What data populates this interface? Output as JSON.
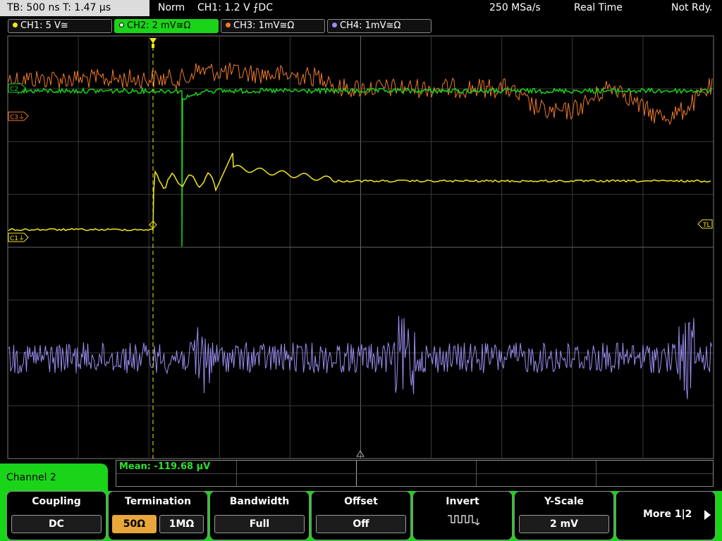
{
  "topbar": {
    "tb": "TB: 500 ns  T: 1.47 µs",
    "mode": "Norm",
    "trigger": "CH1: 1.2 V ⨍DC",
    "sample_rate": "250 MSa/s",
    "acq_mode": "Real Time",
    "status": "Not Rdy."
  },
  "channel_tabs": [
    {
      "label": "CH1: 5 V≅",
      "color": "#f0e81c"
    },
    {
      "label": "CH2: 2 mV≅Ω",
      "color": "#1ad41a"
    },
    {
      "label": "CH3: 1mV≅Ω",
      "color": "#f07a2a"
    },
    {
      "label": "CH4: 1mV≅Ω",
      "color": "#9a8ef0"
    }
  ],
  "markers": {
    "c1": "C1⏚",
    "c3": "C3⏚",
    "c2": "C2",
    "tl": "TL"
  },
  "measurement": {
    "mean": "Mean: -119.68 µV"
  },
  "menu": {
    "title": "Channel 2",
    "coupling_label": "Coupling",
    "coupling_value": "DC",
    "termination_label": "Termination",
    "termination_opt1": "50Ω",
    "termination_opt2": "1MΩ",
    "bandwidth_label": "Bandwidth",
    "bandwidth_value": "Full",
    "offset_label": "Offset",
    "offset_value": "Off",
    "invert_label": "Invert",
    "yscale_label": "Y-Scale",
    "yscale_value": "2 mV",
    "more_label": "More 1|2"
  },
  "colors": {
    "ch1": "#f0e81c",
    "ch2": "#1ad41a",
    "ch3": "#f07a2a",
    "ch4": "#9a8ef0",
    "accent_green": "#1ad41a",
    "grid": "#555555"
  }
}
